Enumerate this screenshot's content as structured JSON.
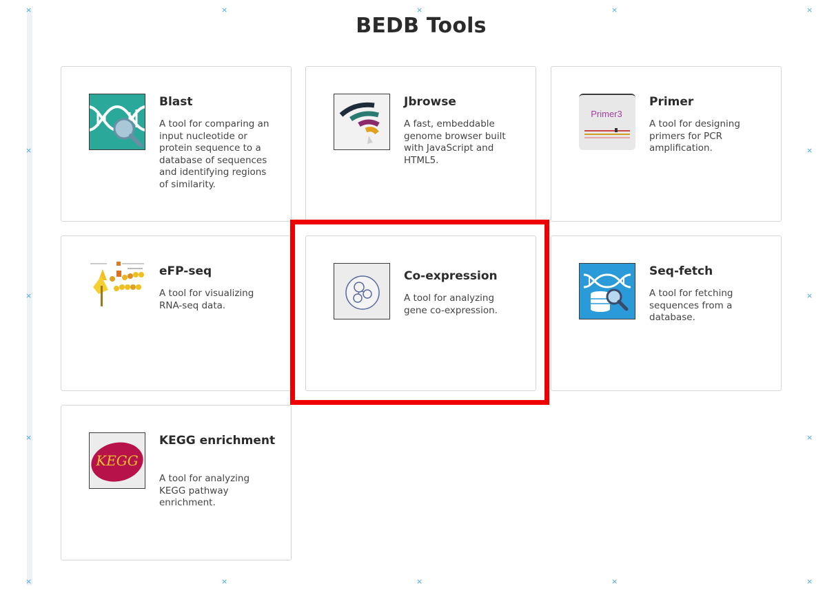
{
  "page": {
    "title": "BEDB Tools"
  },
  "colors": {
    "highlight": "#ee0000",
    "marker": "#4aa8e0"
  },
  "markers": [
    "×",
    "×",
    "×",
    "×",
    "×",
    "×",
    "×",
    "×",
    "×",
    "×",
    "×",
    "×",
    "×",
    "×",
    "×",
    "×"
  ],
  "tools": [
    {
      "name": "Blast",
      "desc": "A tool for comparing an input nucleotide or protein sequence to a database of sequences and identifying regions of similarity.",
      "icon": "blast-dna-magnifier-icon"
    },
    {
      "name": "Jbrowse",
      "desc": "A fast, embeddable genome browser built with JavaScript and HTML5.",
      "icon": "jbrowse-arcs-icon"
    },
    {
      "name": "Primer",
      "desc": "A tool for designing primers for PCR amplification.",
      "icon": "primer3-icon",
      "icon_text": "Primer3"
    },
    {
      "name": "eFP-seq",
      "desc": "A tool for visualizing RNA-seq data.",
      "icon": "efp-seq-plant-icon"
    },
    {
      "name": "Co-expression",
      "desc": "A tool for analyzing gene co-expression.",
      "icon": "co-expression-bubbles-icon"
    },
    {
      "name": "Seq-fetch",
      "desc": "A tool for fetching sequences from a database.",
      "icon": "seq-fetch-database-icon"
    },
    {
      "name": "KEGG enrichment",
      "desc": "A tool for analyzing KEGG pathway enrichment.",
      "icon": "kegg-logo-icon",
      "icon_text": "KEGG"
    }
  ]
}
